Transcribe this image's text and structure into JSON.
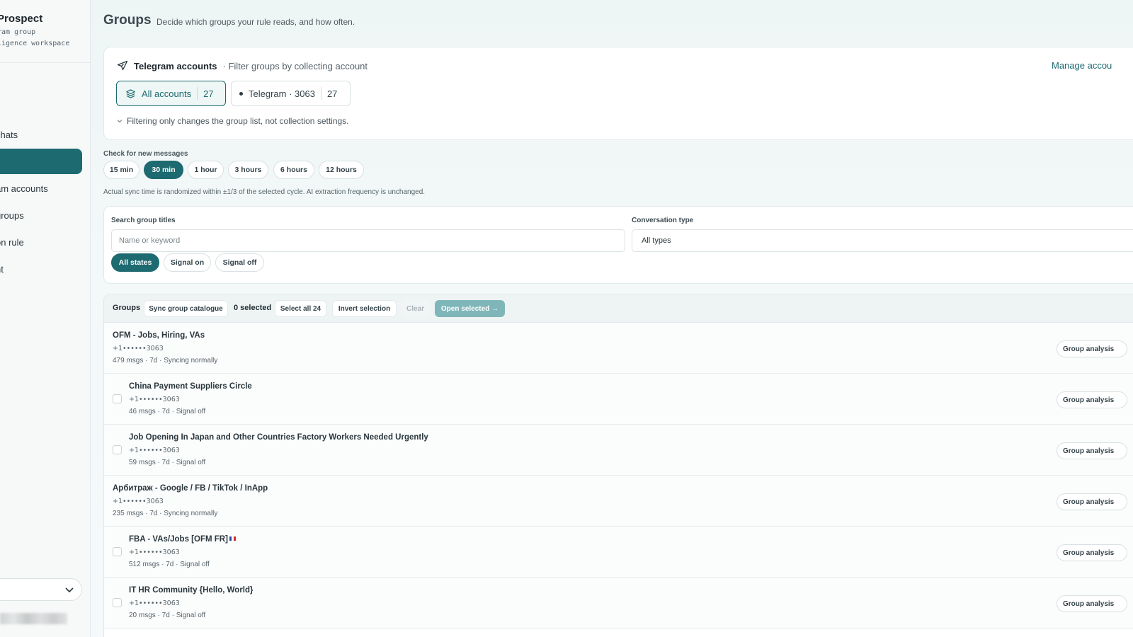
{
  "sidebar": {
    "brand_name": "Prospect",
    "brand_sub_line1": "ram group",
    "brand_sub_line2": "ligence workspace",
    "items": [
      {
        "label": "chats",
        "active": false
      },
      {
        "label": "",
        "active": true
      },
      {
        "label": "am accounts",
        "active": false
      },
      {
        "label": "groups",
        "active": false
      },
      {
        "label": "on rule",
        "active": false
      },
      {
        "label": "nt",
        "active": false
      }
    ],
    "account_select_icon": "chevron-down-icon"
  },
  "header": {
    "title": "Groups",
    "subtitle": "Decide which groups your rule reads, and how often."
  },
  "accounts_card": {
    "icon": "send-icon",
    "title": "Telegram accounts",
    "description": "· Filter groups by collecting account",
    "manage_link": "Manage accou",
    "chips": [
      {
        "label": "All accounts",
        "count": "27",
        "icon": "layers-icon",
        "active": true
      },
      {
        "label": "Telegram · 3063",
        "count": "27",
        "icon": "status-dot",
        "active": false
      }
    ],
    "note": "Filtering only changes the group list, not collection settings."
  },
  "frequency": {
    "label": "Check for new messages",
    "options": [
      "15 min",
      "30 min",
      "1 hour",
      "3 hours",
      "6 hours",
      "12 hours"
    ],
    "selected": "30 min",
    "note": "Actual sync time is randomized within ±1/3 of the selected cycle. AI extraction frequency is unchanged."
  },
  "filters": {
    "search_label": "Search group titles",
    "search_placeholder": "Name or keyword",
    "type_label": "Conversation type",
    "type_value": "All types",
    "states": [
      "All states",
      "Signal on",
      "Signal off"
    ],
    "selected_state": "All states"
  },
  "list_toolbar": {
    "label": "Groups",
    "sync_button": "Sync group catalogue",
    "selected_count": "0 selected",
    "select_all": "Select all 24",
    "invert": "Invert selection",
    "clear": "Clear",
    "open_selected": "Open selected →"
  },
  "groups": [
    {
      "title": "OFM - Jobs, Hiring, VAs",
      "phone": "+1••••••3063",
      "meta": "479 msgs · 7d · Syncing normally",
      "checkbox": false,
      "flag": false,
      "action": "Group analysis"
    },
    {
      "title": "China Payment Suppliers Circle",
      "phone": "+1••••••3063",
      "meta": "46 msgs · 7d · Signal off",
      "checkbox": true,
      "flag": false,
      "action": "Group analysis"
    },
    {
      "title": "Job Opening In Japan and Other Countries Factory Workers Needed Urgently",
      "phone": "+1••••••3063",
      "meta": "59 msgs · 7d · Signal off",
      "checkbox": true,
      "flag": false,
      "action": "Group analysis"
    },
    {
      "title": "Арбитраж - Google / FB / TikTok / InApp",
      "phone": "+1••••••3063",
      "meta": "235 msgs · 7d · Syncing normally",
      "checkbox": false,
      "flag": false,
      "action": "Group analysis"
    },
    {
      "title": "FBA - VAs/Jobs [OFM FR]",
      "phone": "+1••••••3063",
      "meta": "512 msgs · 7d · Signal off",
      "checkbox": true,
      "flag": true,
      "action": "Group analysis"
    },
    {
      "title": "IT HR Community {Hello, World}",
      "phone": "+1••••••3063",
      "meta": "20 msgs · 7d · Signal off",
      "checkbox": true,
      "flag": false,
      "action": "Group analysis"
    }
  ]
}
